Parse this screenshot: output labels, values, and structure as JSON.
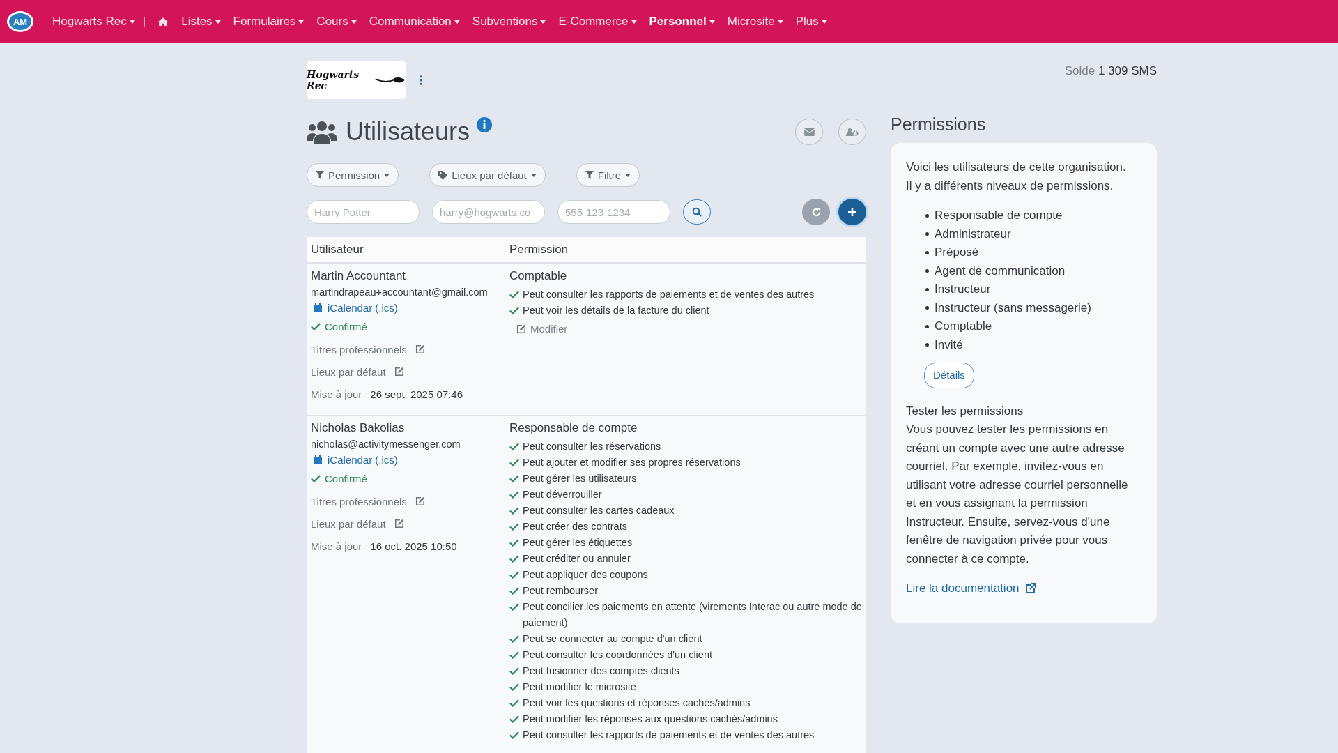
{
  "navbar": {
    "brand_logo": "AM",
    "organization": "Hogwarts Rec",
    "separator": "|",
    "menu": [
      {
        "label": "Listes",
        "selected": false
      },
      {
        "label": "Formulaires",
        "selected": false
      },
      {
        "label": "Cours",
        "selected": false
      },
      {
        "label": "Communication",
        "selected": false
      },
      {
        "label": "Subventions",
        "selected": false
      },
      {
        "label": "E-Commerce",
        "selected": false
      },
      {
        "label": "Personnel",
        "selected": true
      },
      {
        "label": "Microsite",
        "selected": false
      },
      {
        "label": "Plus",
        "selected": false
      }
    ]
  },
  "org_logo": {
    "text": "Hogwarts Rec"
  },
  "balance": {
    "label": "Solde",
    "value": "1 309 SMS"
  },
  "page_title": "Utilisateurs",
  "filters": [
    {
      "kind": "filter",
      "label": "Permission"
    },
    {
      "kind": "tag",
      "label": "Lieux par défaut"
    },
    {
      "kind": "filter",
      "label": "Filtre"
    }
  ],
  "search_fields": [
    {
      "placeholder": "Harry Potter"
    },
    {
      "placeholder": "harry@hogwarts.co"
    },
    {
      "placeholder": "555-123-1234"
    }
  ],
  "table": {
    "columns": [
      "Utilisateur",
      "Permission"
    ],
    "rows": [
      {
        "name": "Martin Accountant",
        "email": "martindrapeau+accountant@gmail.com",
        "calendar_link": "iCalendar (.ics)",
        "status": "Confirmé",
        "confirmed": true,
        "fields": [
          {
            "label": "Titres professionnels",
            "kind": "edit"
          },
          {
            "label": "Lieux par défaut",
            "kind": "edit"
          },
          {
            "label": "Mise à jour",
            "kind": "value",
            "value": "26 sept. 2025 07:46"
          }
        ],
        "role": "Comptable",
        "permissions": [
          "Peut consulter les rapports de paiements et de ventes des autres",
          "Peut voir les détails de la facture du client"
        ],
        "edit_link": "Modifier"
      },
      {
        "name": "Nicholas Bakolias",
        "email": "nicholas@activitymessenger.com",
        "calendar_link": "iCalendar (.ics)",
        "status": "Confirmé",
        "confirmed": true,
        "fields": [
          {
            "label": "Titres professionnels",
            "kind": "edit"
          },
          {
            "label": "Lieux par défaut",
            "kind": "edit"
          },
          {
            "label": "Mise à jour",
            "kind": "value",
            "value": "16 oct. 2025 10:50"
          }
        ],
        "role": "Responsable de compte",
        "permissions": [
          "Peut consulter les réservations",
          "Peut ajouter et modifier ses propres réservations",
          "Peut gérer les utilisateurs",
          "Peut déverrouiller",
          "Peut consulter les cartes cadeaux",
          "Peut créer des contrats",
          "Peut gérer les étiquettes",
          "Peut créditer ou annuler",
          "Peut appliquer des coupons",
          "Peut rembourser",
          "Peut concilier les paiements en attente (virements Interac ou autre mode de paiement)",
          "Peut se connecter au compte d'un client",
          "Peut consulter les coordonnées d'un client",
          "Peut fusionner des comptes clients",
          "Peut modifier le microsite",
          "Peut voir les questions et réponses cachés/admins",
          "Peut modifier les réponses aux questions cachés/admins",
          "Peut consulter les rapports de paiements et de ventes des autres"
        ]
      }
    ]
  },
  "side_panel": {
    "title": "Permissions",
    "intro": "Voici les utilisateurs de cette organisation. Il y a différents niveaux de permissions.",
    "levels": [
      "Responsable de compte",
      "Administrateur",
      "Préposé",
      "Agent de communication",
      "Instructeur",
      "Instructeur (sans messagerie)",
      "Comptable",
      "Invité"
    ],
    "details_button": "Détails",
    "test_title": "Tester les permissions",
    "test_text": "Vous pouvez tester les permissions en créant un compte avec une autre adresse courriel. Par exemple, invitez-vous en utilisant votre adresse courriel personnelle et en vous assignant la permission Instructeur. Ensuite, servez-vous d'une fenêtre de navigation privée pour vous connecter à ce compte.",
    "doc_link": "Lire la documentation"
  }
}
